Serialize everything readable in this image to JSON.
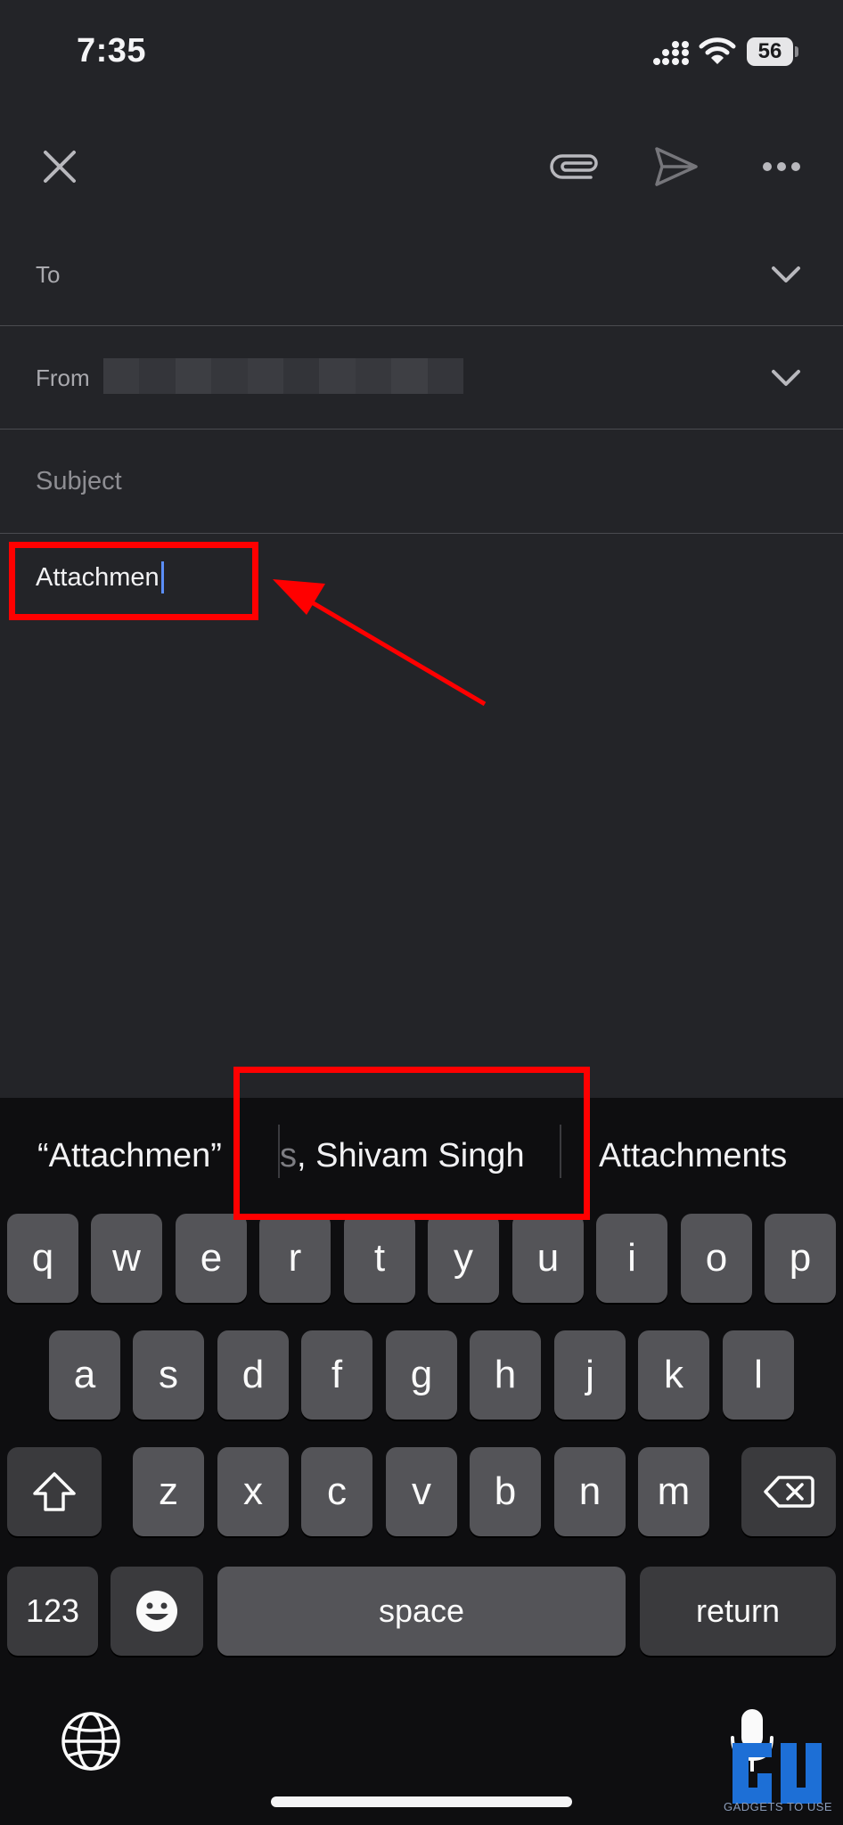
{
  "status_bar": {
    "time": "7:35",
    "battery": "56",
    "icons": [
      "signal-icon",
      "wifi-icon",
      "battery-icon"
    ]
  },
  "toolbar": {
    "icons": [
      "close-icon",
      "paperclip-icon",
      "send-icon",
      "more-icon"
    ]
  },
  "fields": {
    "to_label": "To",
    "from_label": "From",
    "subject_placeholder": "Subject"
  },
  "body": {
    "text": "Attachmen"
  },
  "suggestions": {
    "first": "“Attachmen”",
    "second_dim": "s",
    "second": ", Shivam Singh",
    "third": "Attachments"
  },
  "keyboard": {
    "row1": [
      "q",
      "w",
      "e",
      "r",
      "t",
      "y",
      "u",
      "i",
      "o",
      "p"
    ],
    "row2": [
      "a",
      "s",
      "d",
      "f",
      "g",
      "h",
      "j",
      "k",
      "l"
    ],
    "row3": [
      "z",
      "x",
      "c",
      "v",
      "b",
      "n",
      "m"
    ],
    "numbers_key": "123",
    "space_key": "space",
    "return_key": "return"
  },
  "watermark": {
    "text": "GADGETS TO USE"
  },
  "colors": {
    "background": "#232428",
    "keyboard_bg": "#0e0e10",
    "key": "#545458",
    "annotation": "#ff0000",
    "caret": "#5b8ef7"
  }
}
